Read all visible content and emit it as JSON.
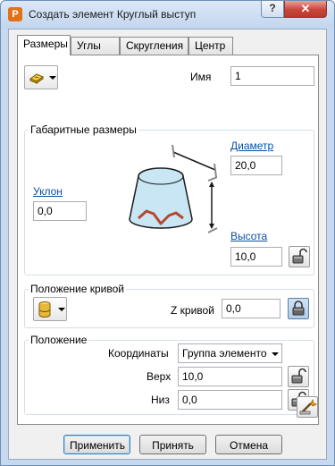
{
  "window": {
    "title": "Создать элемент Круглый выступ",
    "app_icon_letter": "P",
    "help_glyph": "?",
    "close_glyph": "✕"
  },
  "tabs": [
    {
      "label": "Размеры",
      "active": true
    },
    {
      "label": "Углы",
      "active": false
    },
    {
      "label": "Скругления",
      "active": false
    },
    {
      "label": "Центр",
      "active": false
    }
  ],
  "name_field": {
    "label": "Имя",
    "value": "1"
  },
  "dimensions": {
    "group_label": "Габаритные размеры",
    "diameter": {
      "label": "Диаметр",
      "value": "20,0"
    },
    "taper": {
      "label": "Уклон",
      "value": "0,0"
    },
    "height": {
      "label": "Высота",
      "value": "10,0"
    }
  },
  "curve_position": {
    "group_label": "Положение кривой",
    "z_label": "Z кривой",
    "z_value": "0,0"
  },
  "position": {
    "group_label": "Положение",
    "coords_label": "Координаты",
    "coords_value": "Группа элементо",
    "top_label": "Верх",
    "top_value": "10,0",
    "bottom_label": "Низ",
    "bottom_value": "0,0"
  },
  "footer": {
    "apply": "Применить",
    "accept": "Принять",
    "cancel": "Отмена"
  },
  "colors": {
    "link": "#0b4fa0",
    "cone_fill": "#c8e6f4",
    "cone_stroke": "#1a1a1a",
    "accent_profile": "#b5482f",
    "app_icon": "#e0731a"
  }
}
